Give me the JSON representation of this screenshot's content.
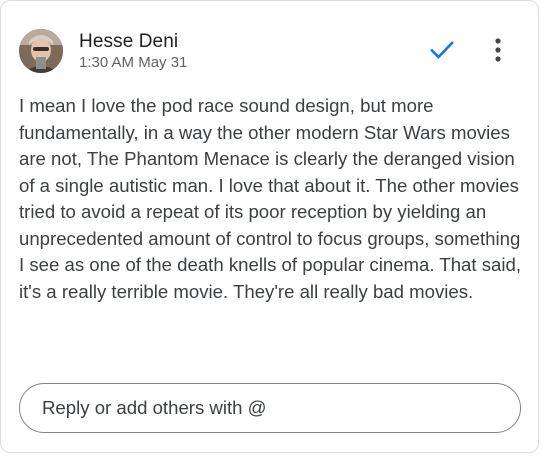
{
  "comment": {
    "author": "Hesse Deni",
    "timestamp": "1:30 AM May 31",
    "body": "I mean I love the pod race sound design, but more fundamentally, in a way the other modern Star Wars movies are not, The Phantom Menace is clearly the deranged vision of a single autistic man. I love that about it. The other movies tried to avoid a repeat of its poor reception by yielding an unprecedented amount of control to focus groups, something I see as one of the death knells of popular cinema. That said, it's a really terrible movie. They're all really bad movies."
  },
  "actions": {
    "resolve_icon": "checkmark-icon",
    "more_icon": "more-vert-icon"
  },
  "reply": {
    "placeholder": "Reply or add others with @"
  },
  "colors": {
    "accent": "#1a73e8",
    "icon": "#444746",
    "border": "#dadce0",
    "reply_border": "#80868b"
  }
}
